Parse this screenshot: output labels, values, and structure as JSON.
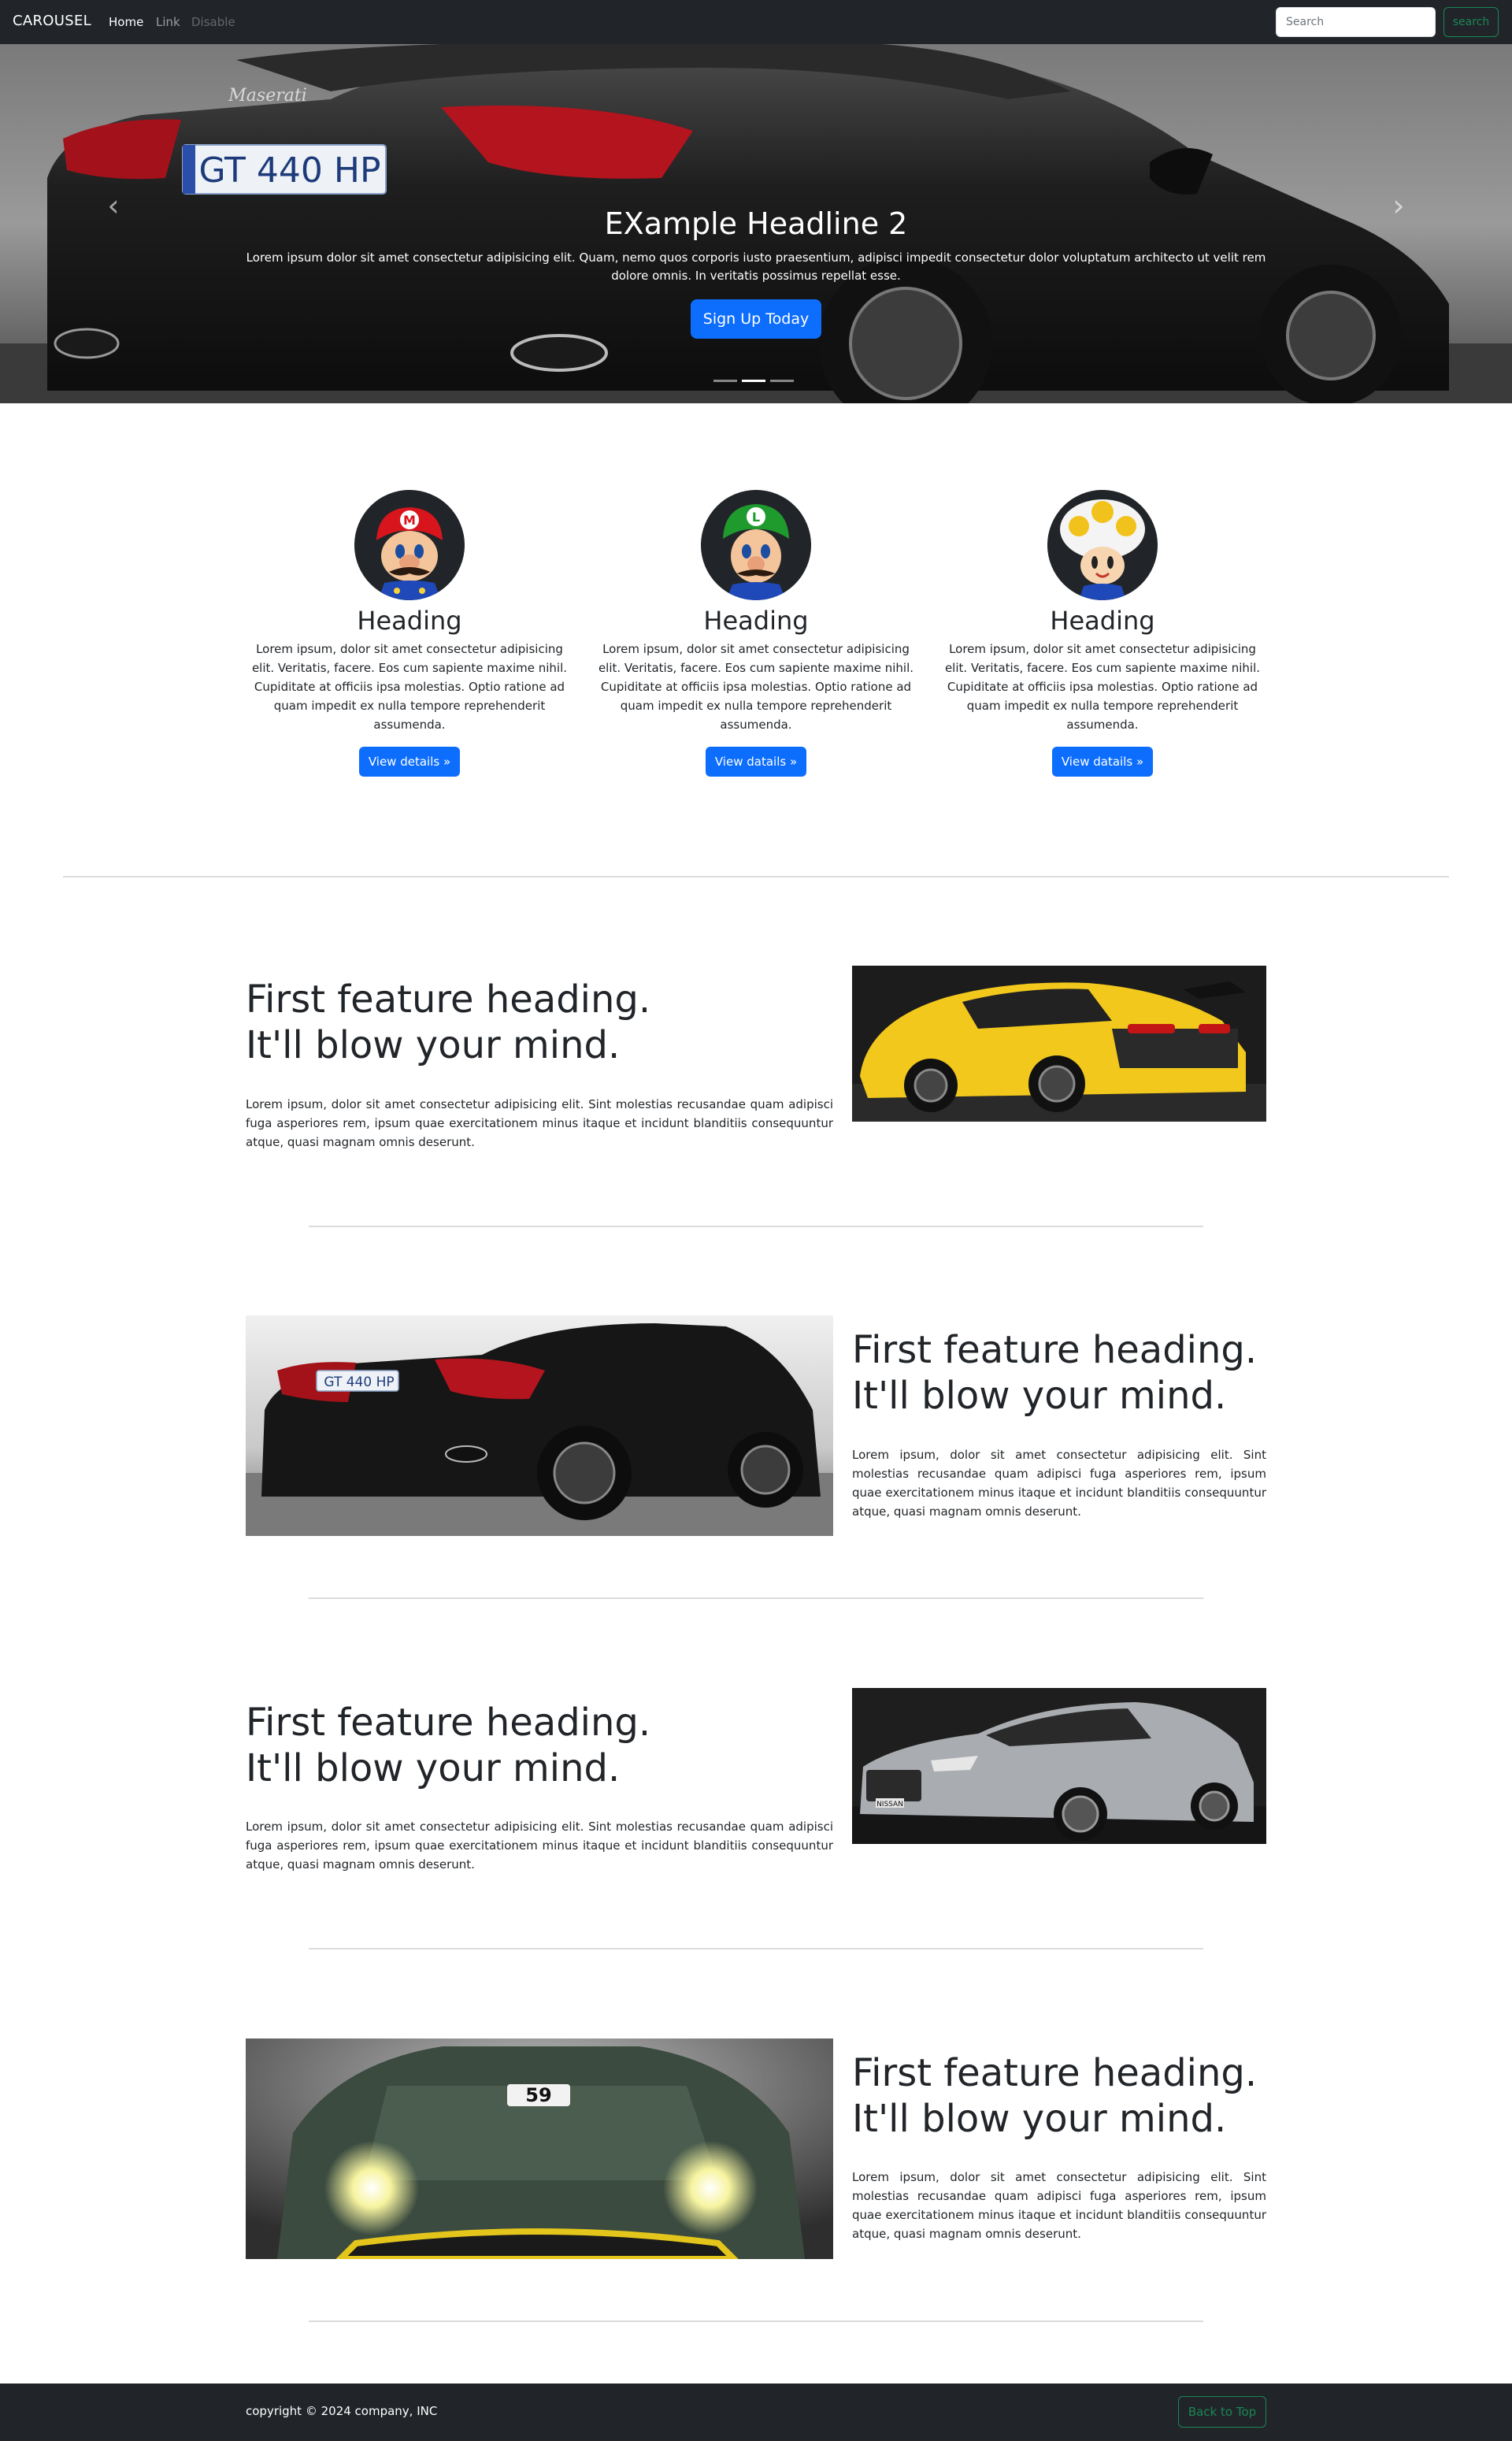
{
  "navbar": {
    "brand": "CAROUSEL",
    "links": [
      {
        "label": "Home"
      },
      {
        "label": "Link"
      },
      {
        "label": "Disable"
      }
    ],
    "search_placeholder": "Search",
    "search_button": "search"
  },
  "hero": {
    "title": "EXample Headline 2",
    "text": "Lorem ipsum dolor sit amet consectetur adipisicing elit. Quam, nemo quos corporis iusto praesentium, adipisci impedit consectetur dolor voluptatum architecto ut velit rem dolore omnis. In veritatis possimus repellat esse.",
    "button": "Sign Up Today",
    "license_plate": "GT 440 HP",
    "car_brand_script": "Maserati",
    "active_slide": 2,
    "slide_count": 3
  },
  "marketing": [
    {
      "heading": "Heading",
      "avatar": "mario-avatar",
      "text": "Lorem ipsum, dolor sit amet consectetur adipisicing elit. Veritatis, facere. Eos cum sapiente maxime nihil. Cupiditate at officiis ipsa molestias. Optio ratione ad quam impedit ex nulla tempore reprehenderit assumenda.",
      "button": "View details »"
    },
    {
      "heading": "Heading",
      "avatar": "luigi-avatar",
      "text": "Lorem ipsum, dolor sit amet consectetur adipisicing elit. Veritatis, facere. Eos cum sapiente maxime nihil. Cupiditate at officiis ipsa molestias. Optio ratione ad quam impedit ex nulla tempore reprehenderit assumenda.",
      "button": "View datails »"
    },
    {
      "heading": "Heading",
      "avatar": "toad-avatar",
      "text": "Lorem ipsum, dolor sit amet consectetur adipisicing elit. Veritatis, facere. Eos cum sapiente maxime nihil. Cupiditate at officiis ipsa molestias. Optio ratione ad quam impedit ex nulla tempore reprehenderit assumenda.",
      "button": "View datails »"
    }
  ],
  "featurettes": [
    {
      "heading_line1": "First feature heading.",
      "heading_line2": "It'll blow your mind.",
      "text": "Lorem ipsum, dolor sit amet consectetur adipisicing elit. Sint molestias recusandae quam adipisci fuga asperiores rem, ipsum quae exercitationem minus itaque et incidunt blanditiis consequuntur atque, quasi magnam omnis deserunt.",
      "image": "yellow-sports-car"
    },
    {
      "heading_line1": "First feature heading.",
      "heading_line2": "It'll blow your mind.",
      "text": "Lorem ipsum, dolor sit amet consectetur adipisicing elit. Sint molestias recusandae quam adipisci fuga asperiores rem, ipsum quae exercitationem minus itaque et incidunt blanditiis consequuntur atque, quasi magnam omnis deserunt.",
      "image": "black-maserati",
      "plate": "GT 440 HP"
    },
    {
      "heading_line1": "First feature heading.",
      "heading_line2": "It'll blow your mind.",
      "text": "Lorem ipsum, dolor sit amet consectetur adipisicing elit. Sint molestias recusandae quam adipisci fuga asperiores rem, ipsum quae exercitationem minus itaque et incidunt blanditiis consequuntur atque, quasi magnam omnis deserunt.",
      "image": "silver-nissan-gtr",
      "badge": "NISSAN"
    },
    {
      "heading_line1": "First feature heading.",
      "heading_line2": "It'll blow your mind.",
      "text": "Lorem ipsum, dolor sit amet consectetur adipisicing elit. Sint molestias recusandae quam adipisci fuga asperiores rem, ipsum quae exercitationem minus itaque et incidunt blanditiis consequuntur atque, quasi magnam omnis deserunt.",
      "image": "green-race-car",
      "race_number": "59"
    }
  ],
  "footer": {
    "copyright": "copyright © 2024 company, INC",
    "back_to_top": "Back to Top"
  },
  "colors": {
    "dark": "#212529",
    "primary": "#0d6efd",
    "success": "#198754"
  }
}
